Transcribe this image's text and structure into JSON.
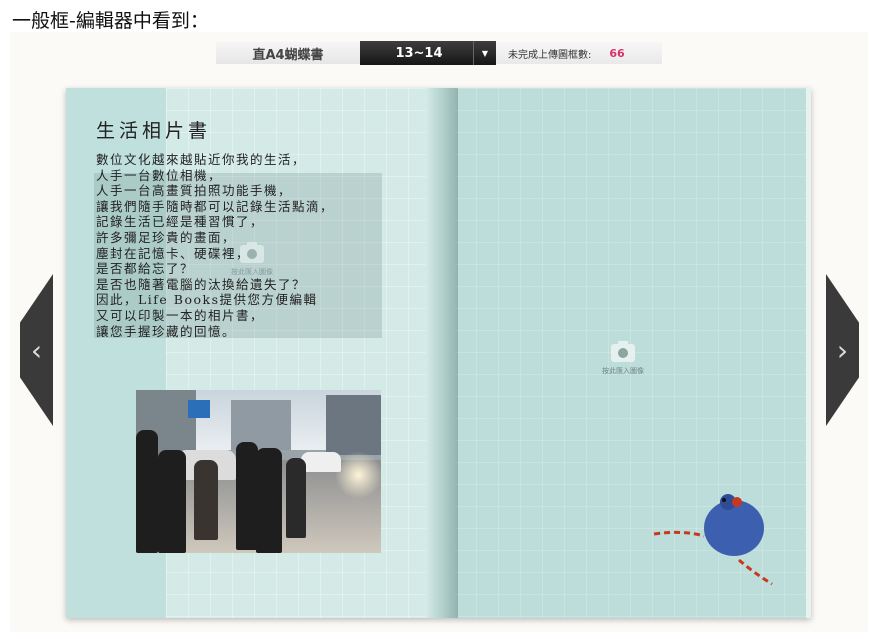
{
  "heading": "一般框-編輯器中看到：",
  "toolbar": {
    "book_type": "直A4蝴蝶書",
    "page_select": "13~14",
    "upload_label": "未完成上傳圖框數:",
    "upload_count": "66"
  },
  "left_page": {
    "title": "生活相片書",
    "poem_lines": [
      "數位文化越來越貼近你我的生活，",
      "人手一台數位相機，",
      "人手一台高畫質拍照功能手機，",
      "讓我們隨手隨時都可以記錄生活點滴，",
      "記錄生活已經是種習慣了，",
      "許多彌足珍貴的畫面，",
      "塵封在記憶卡、硬碟裡，",
      "是否都給忘了？",
      "是否也隨著電腦的汰換給遺失了？",
      "因此，Life Books提供您方便編輯",
      "又可以印製一本的相片書，",
      "讓您手握珍藏的回憶。"
    ],
    "photo_slot_label": "按此匯入圖像"
  },
  "right_page": {
    "photo_slot_label": "按此匯入圖像"
  },
  "icons": {
    "prev": "chevron-left-icon",
    "next": "chevron-right-icon",
    "dropdown": "caret-down-icon",
    "camera": "camera-icon"
  },
  "colors": {
    "page_bg": "#bcddd9",
    "count_accent": "#d6336c",
    "nav_bg": "#3a3a3a"
  }
}
